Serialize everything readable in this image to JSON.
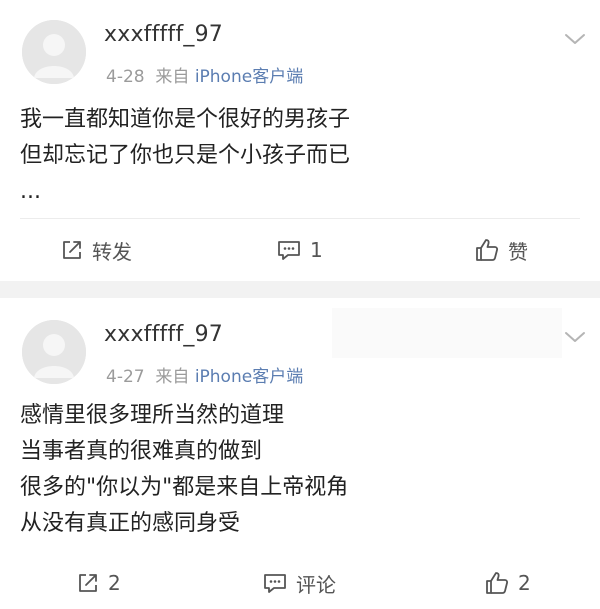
{
  "posts": [
    {
      "username": "xxxfffff_97",
      "date": "4-28",
      "from_label": "来自",
      "source": "iPhone客户端",
      "lines": [
        "我一直都知道你是个很好的男孩子",
        "但却忘记了你也只是个小孩子而已",
        "..."
      ],
      "share_label": "转发",
      "comment_count": "1",
      "like_label": "赞"
    },
    {
      "username": "xxxfffff_97",
      "date": "4-27",
      "from_label": "来自",
      "source": "iPhone客户端",
      "lines": [
        "感情里很多理所当然的道理",
        "当事者真的很难真的做到",
        "很多的\"你以为\"都是来自上帝视角",
        "从没有真正的感同身受"
      ],
      "share_count": "2",
      "comment_label": "评论",
      "like_count": "2"
    }
  ],
  "icons": {
    "share": "share-icon",
    "comment": "comment-icon",
    "like": "thumbs-up-icon",
    "more": "chevron-down-icon"
  },
  "colors": {
    "background": "#f2f2f2",
    "card": "#ffffff",
    "source_link": "#5b7db1",
    "meta_gray": "#9b9b9b",
    "avatar_placeholder": "#e8e8e8"
  }
}
